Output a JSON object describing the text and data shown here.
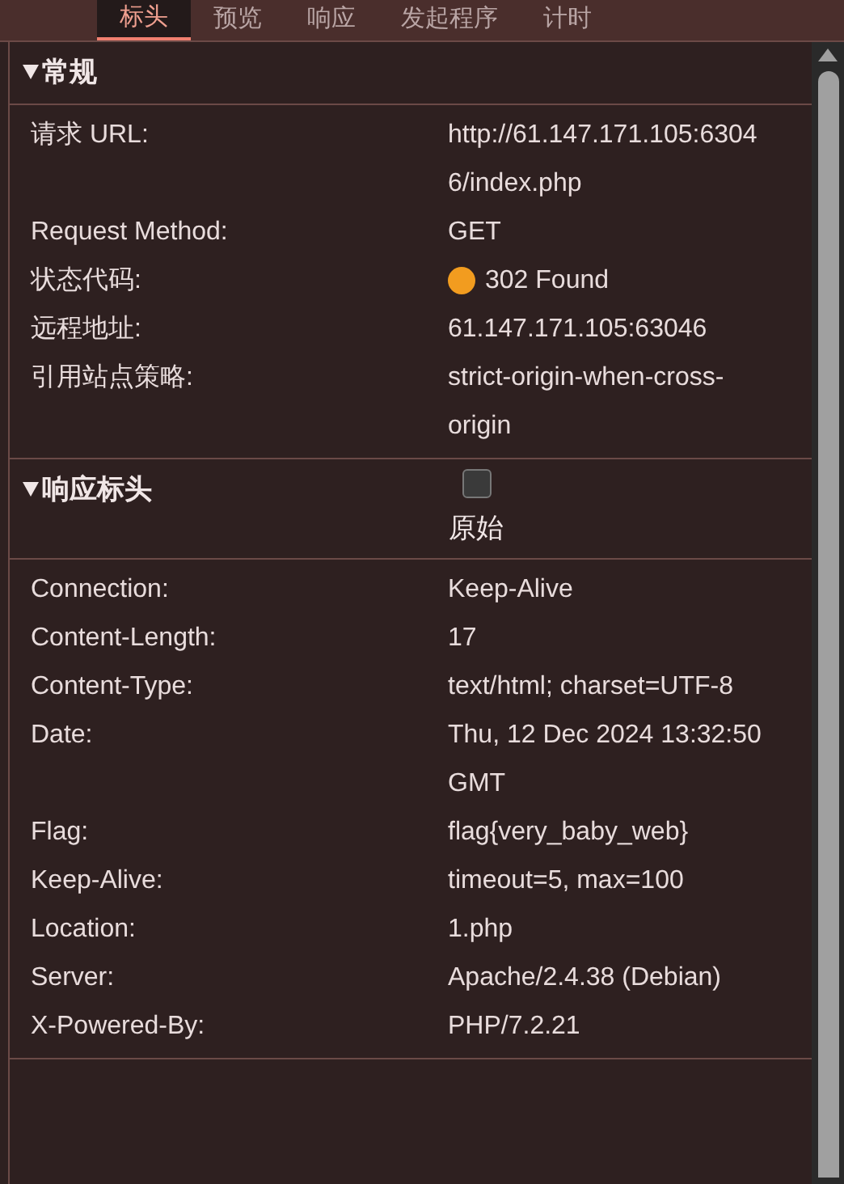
{
  "tabs": [
    {
      "label": "标头",
      "selected": true
    },
    {
      "label": "预览",
      "selected": false
    },
    {
      "label": "响应",
      "selected": false
    },
    {
      "label": "发起程序",
      "selected": false
    },
    {
      "label": "计时",
      "selected": false
    }
  ],
  "general": {
    "title": "常规",
    "expanded": true,
    "rows": [
      {
        "name": "请求 URL:",
        "value": "http://61.147.171.105:63046/index.php"
      },
      {
        "name": "Request Method:",
        "value": "GET"
      },
      {
        "name": "状态代码:",
        "value": "302 Found",
        "color": "#f29c1f"
      },
      {
        "name": "远程地址:",
        "value": "61.147.171.105:63046"
      },
      {
        "name": "引用站点策略:",
        "value": "strict-origin-when-cross-origin"
      }
    ]
  },
  "response_headers": {
    "title": "响应标头",
    "expanded": true,
    "raw": {
      "label": "原始",
      "checked": false
    },
    "rows": [
      {
        "name": "Connection:",
        "value": "Keep-Alive"
      },
      {
        "name": "Content-Length:",
        "value": "17"
      },
      {
        "name": "Content-Type:",
        "value": "text/html; charset=UTF-8"
      },
      {
        "name": "Date:",
        "value": "Thu, 12 Dec 2024 13:32:50 GMT"
      },
      {
        "name": "Flag:",
        "value": "flag{very_baby_web}"
      },
      {
        "name": "Keep-Alive:",
        "value": "timeout=5, max=100"
      },
      {
        "name": "Location:",
        "value": "1.php"
      },
      {
        "name": "Server:",
        "value": "Apache/2.4.38 (Debian)"
      },
      {
        "name": "X-Powered-By:",
        "value": "PHP/7.2.21"
      }
    ]
  }
}
